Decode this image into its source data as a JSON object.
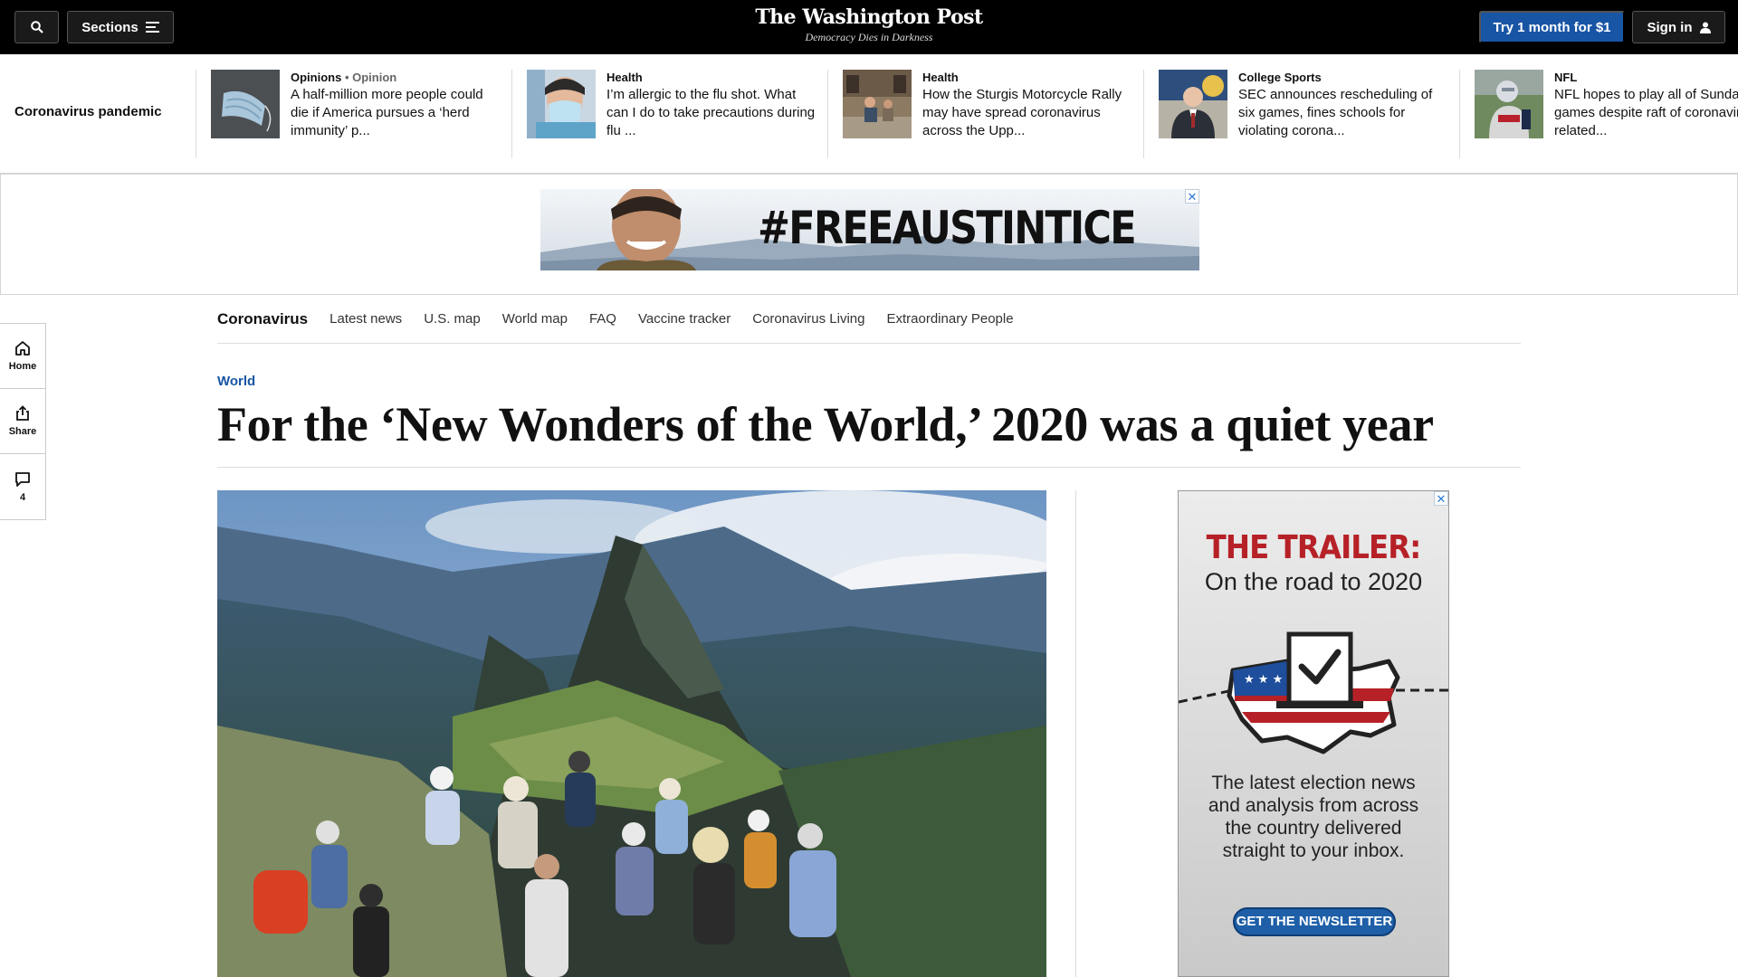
{
  "header": {
    "sections_label": "Sections",
    "brand": "The Washington Post",
    "tagline": "Democracy Dies in Darkness",
    "subscribe_label": "Try 1 month for $1",
    "signin_label": "Sign in"
  },
  "strip": {
    "label": "Coronavirus pandemic",
    "items": [
      {
        "kicker": "Opinions",
        "kicker2": "• Opinion",
        "headline": "A half-million more people could die if America pursues a ‘herd immunity’ p..."
      },
      {
        "kicker": "Health",
        "kicker2": "",
        "headline": "I’m allergic to the flu shot. What can I do to take precautions during flu ..."
      },
      {
        "kicker": "Health",
        "kicker2": "",
        "headline": "How the Sturgis Motorcycle Rally may have spread coronavirus across the Upp..."
      },
      {
        "kicker": "College Sports",
        "kicker2": "",
        "headline": "SEC announces rescheduling of six games, fines schools for violating corona..."
      },
      {
        "kicker": "NFL",
        "kicker2": "",
        "headline": "NFL hopes to play all of Sunday's games despite raft of coronavirus-related..."
      }
    ]
  },
  "ad_banner": {
    "hashtag": "#FREEAUSTINTICE",
    "close": "✕"
  },
  "subnav": {
    "title": "Coronavirus",
    "links": [
      "Latest news",
      "U.S. map",
      "World map",
      "FAQ",
      "Vaccine tracker",
      "Coronavirus Living",
      "Extraordinary People"
    ]
  },
  "rail": {
    "home": "Home",
    "share": "Share",
    "comments": "4"
  },
  "article": {
    "kicker": "World",
    "headline": "For the ‘New Wonders of the World,’ 2020 was a quiet year"
  },
  "side_ad": {
    "title": "THE TRAILER:",
    "subtitle": "On the road to 2020",
    "body": "The latest election news and analysis from across the country delivered straight to your inbox.",
    "cta": "GET THE NEWSLETTER",
    "close": "✕"
  },
  "colors": {
    "accent_blue": "#1955a5",
    "ad_red": "#b62127",
    "topbar": "#000000"
  }
}
